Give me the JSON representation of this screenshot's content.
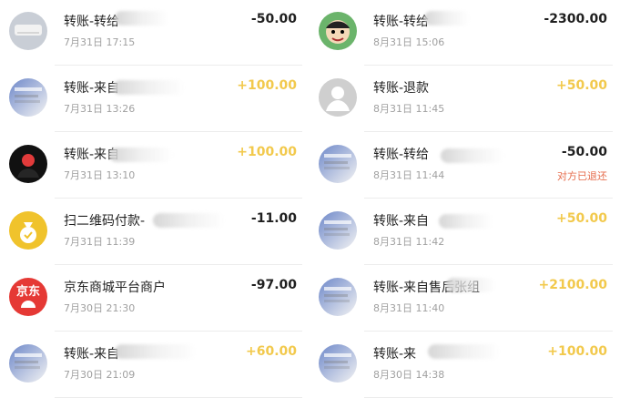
{
  "left": [
    {
      "title": "转账-转给",
      "time": "7月31日 17:15",
      "amount": "-50.00",
      "sign": "neg",
      "note": "",
      "avatar": "ac-icon",
      "avatar_color": "#d7dbe0"
    },
    {
      "title": "转账-来自",
      "time": "7月31日 13:26",
      "amount": "+100.00",
      "sign": "pos",
      "note": "",
      "avatar": "photo-icon",
      "avatar_color": "#6e88c9"
    },
    {
      "title": "转账-来自",
      "time": "7月31日 13:10",
      "amount": "+100.00",
      "sign": "pos",
      "note": "",
      "avatar": "person-icon",
      "avatar_color": "#1f1f1f"
    },
    {
      "title": "扫二维码付款-",
      "time": "7月31日 11:39",
      "amount": "-11.00",
      "sign": "neg",
      "note": "",
      "avatar": "moneybag-icon",
      "avatar_color": "#f0c32c"
    },
    {
      "title": "京东商城平台商户",
      "time": "7月30日 21:30",
      "amount": "-97.00",
      "sign": "neg",
      "note": "",
      "avatar": "jd-logo",
      "avatar_color": "#e53935",
      "avatar_text": "京东"
    },
    {
      "title": "转账-来自",
      "time": "7月30日 21:09",
      "amount": "+60.00",
      "sign": "pos",
      "note": "",
      "avatar": "photo-icon",
      "avatar_color": "#d2d2d2"
    }
  ],
  "right": [
    {
      "title": "转账-转给",
      "time": "8月31日 15:06",
      "amount": "-2300.00",
      "sign": "neg",
      "note": "",
      "avatar": "cartoon-icon",
      "avatar_color": "#5fa95f"
    },
    {
      "title": "转账-退款",
      "time": "8月31日 11:45",
      "amount": "+50.00",
      "sign": "pos",
      "note": "",
      "avatar": "default-user-icon",
      "avatar_color": "#c9c9c9"
    },
    {
      "title": "转账-转给",
      "time": "8月31日 11:44",
      "amount": "-50.00",
      "sign": "neg",
      "note": "对方已退还",
      "avatar": "photo-icon",
      "avatar_color": "#cfcfcf"
    },
    {
      "title": "转账-来自",
      "time": "8月31日 11:42",
      "amount": "+50.00",
      "sign": "pos",
      "note": "",
      "avatar": "photo-icon",
      "avatar_color": "#cfcfcf"
    },
    {
      "title": "转账-来自售后张组",
      "time": "8月31日 11:40",
      "amount": "+2100.00",
      "sign": "pos",
      "note": "",
      "avatar": "photo-icon",
      "avatar_color": "#cfcfcf"
    },
    {
      "title": "转账-来",
      "time": "8月30日 14:38",
      "amount": "+100.00",
      "sign": "pos",
      "note": "",
      "avatar": "photo-icon",
      "avatar_color": "#6b4d3a"
    }
  ]
}
